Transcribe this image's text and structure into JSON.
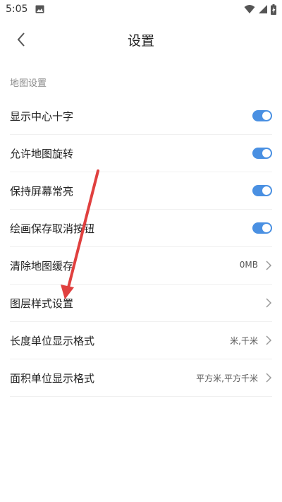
{
  "status_bar": {
    "time": "5:05"
  },
  "header": {
    "title": "设置"
  },
  "section": {
    "label": "地图设置"
  },
  "items": [
    {
      "label": "显示中心十字"
    },
    {
      "label": "允许地图旋转"
    },
    {
      "label": "保持屏幕常亮"
    },
    {
      "label": "绘画保存取消按钮"
    },
    {
      "label": "清除地图缓存",
      "value": "0MB"
    },
    {
      "label": "图层样式设置"
    },
    {
      "label": "长度单位显示格式",
      "value": "米,千米"
    },
    {
      "label": "面积单位显示格式",
      "value": "平方米,平方千米"
    }
  ],
  "colors": {
    "toggle_on": "#4a90e2",
    "annotation_arrow": "#e0403f"
  }
}
